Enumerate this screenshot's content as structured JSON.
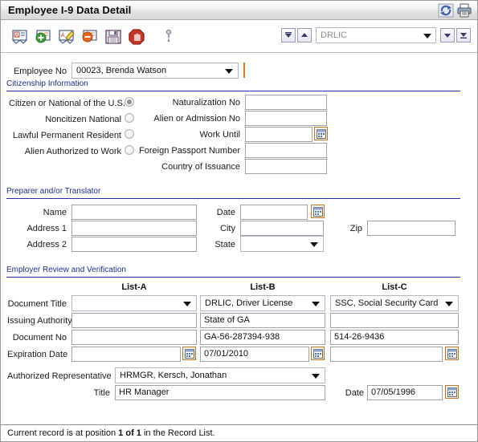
{
  "window": {
    "title": "Employee I-9 Data Detail",
    "titlebar_icons": [
      {
        "name": "refresh-sync-icon",
        "label": "Refresh"
      },
      {
        "name": "print-icon",
        "label": "Print"
      }
    ]
  },
  "toolbar": {
    "buttons": [
      {
        "name": "view-record-button",
        "label": "View Record"
      },
      {
        "name": "add-record-button",
        "label": "Add Record"
      },
      {
        "name": "edit-record-button",
        "label": "Edit Record"
      },
      {
        "name": "delete-record-button",
        "label": "Delete Record"
      },
      {
        "name": "save-button",
        "label": "Save"
      },
      {
        "name": "stop-button",
        "label": "Stop"
      },
      {
        "name": "attach-pin-button",
        "label": "Attach"
      }
    ],
    "nav": {
      "first_label": "First",
      "previous_label": "Previous",
      "next_label": "Next",
      "last_label": "Last"
    },
    "quick_search": {
      "value": "DRLIC",
      "placeholder": "DRLIC"
    }
  },
  "employee": {
    "label": "Employee No",
    "value": "00023, Brenda Watson"
  },
  "citizenship": {
    "section_title": "Citizenship Information",
    "options": [
      {
        "label": "Citizen or National of the U.S.",
        "selected": true
      },
      {
        "label": "Noncitizen National",
        "selected": false
      },
      {
        "label": "Lawful Permanent Resident",
        "selected": false
      },
      {
        "label": "Alien Authorized to Work",
        "selected": false
      }
    ],
    "fields": [
      {
        "label": "Naturalization No",
        "value": "",
        "calendar": false
      },
      {
        "label": "Alien or Admission No",
        "value": "",
        "calendar": false
      },
      {
        "label": "Work Until",
        "value": "",
        "calendar": true
      },
      {
        "label": "Foreign Passport Number",
        "value": "",
        "calendar": false
      },
      {
        "label": "Country of Issuance",
        "value": "",
        "calendar": false
      }
    ]
  },
  "preparer": {
    "section_title": "Preparer and/or Translator",
    "name_label": "Name",
    "name_value": "",
    "address1_label": "Address 1",
    "address1_value": "",
    "address2_label": "Address 2",
    "address2_value": "",
    "date_label": "Date",
    "date_value": "",
    "city_label": "City",
    "city_value": "",
    "state_label": "State",
    "state_value": "",
    "zip_label": "Zip",
    "zip_value": ""
  },
  "employer": {
    "section_title": "Employer Review and Verification",
    "columns": [
      "List-A",
      "List-B",
      "List-C"
    ],
    "rows": [
      {
        "label": "Document Title",
        "type": "combo",
        "values": [
          "",
          "DRLIC, Driver License",
          "SSC, Social Security Card"
        ]
      },
      {
        "label": "Issuing Authority",
        "type": "text",
        "values": [
          "",
          "State of GA",
          ""
        ]
      },
      {
        "label": "Document No",
        "type": "text",
        "values": [
          "",
          "GA-56-287394-938",
          "514-26-9436"
        ]
      },
      {
        "label": "Expiration Date",
        "type": "date",
        "values": [
          "",
          "07/01/2010",
          ""
        ]
      }
    ],
    "authorized_rep_label": "Authorized Representative",
    "authorized_rep_value": "HRMGR, Kersch, Jonathan",
    "title_label": "Title",
    "title_value": "HR Manager",
    "date_label": "Date",
    "date_value": "07/05/1996"
  },
  "status": {
    "prefix": "Current record is at position ",
    "position": "1 of 1",
    "suffix": " in the Record List."
  }
}
